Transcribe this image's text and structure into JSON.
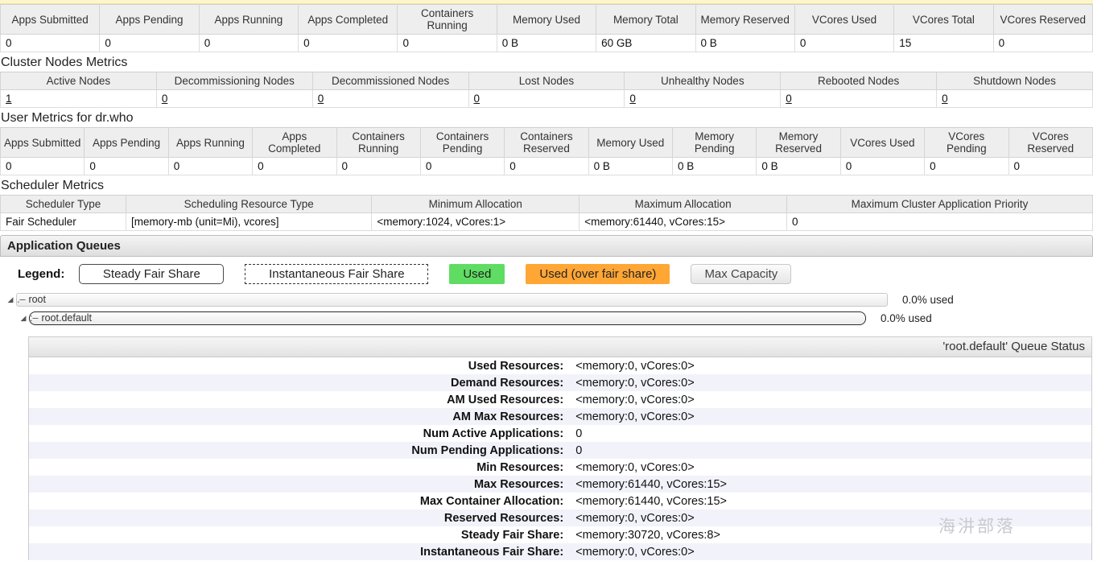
{
  "cluster_metrics": {
    "headers": [
      "Apps Submitted",
      "Apps Pending",
      "Apps Running",
      "Apps Completed",
      "Containers Running",
      "Memory Used",
      "Memory Total",
      "Memory Reserved",
      "VCores Used",
      "VCores Total",
      "VCores Reserved"
    ],
    "values": [
      "0",
      "0",
      "0",
      "0",
      "0",
      "0 B",
      "60 GB",
      "0 B",
      "0",
      "15",
      "0"
    ]
  },
  "cluster_nodes": {
    "title": "Cluster Nodes Metrics",
    "headers": [
      "Active Nodes",
      "Decommissioning Nodes",
      "Decommissioned Nodes",
      "Lost Nodes",
      "Unhealthy Nodes",
      "Rebooted Nodes",
      "Shutdown Nodes"
    ],
    "values": [
      "1",
      "0",
      "0",
      "0",
      "0",
      "0",
      "0"
    ]
  },
  "user_metrics": {
    "title": "User Metrics for dr.who",
    "headers": [
      "Apps Submitted",
      "Apps Pending",
      "Apps Running",
      "Apps Completed",
      "Containers Running",
      "Containers Pending",
      "Containers Reserved",
      "Memory Used",
      "Memory Pending",
      "Memory Reserved",
      "VCores Used",
      "VCores Pending",
      "VCores Reserved"
    ],
    "values": [
      "0",
      "0",
      "0",
      "0",
      "0",
      "0",
      "0",
      "0 B",
      "0 B",
      "0 B",
      "0",
      "0",
      "0"
    ]
  },
  "scheduler_metrics": {
    "title": "Scheduler Metrics",
    "headers": [
      "Scheduler Type",
      "Scheduling Resource Type",
      "Minimum Allocation",
      "Maximum Allocation",
      "Maximum Cluster Application Priority"
    ],
    "values": [
      "Fair Scheduler",
      "[memory-mb (unit=Mi), vcores]",
      "<memory:1024, vCores:1>",
      "<memory:61440, vCores:15>",
      "0"
    ]
  },
  "application_queues": {
    "title": "Application Queues",
    "legend": {
      "label": "Legend:",
      "steady": "Steady Fair Share",
      "instantaneous": "Instantaneous Fair Share",
      "used": "Used",
      "used_over": "Used (over fair share)",
      "max_capacity": "Max Capacity"
    },
    "colors": {
      "used": "#5fdc62",
      "used_over": "#ffa635",
      "max_capacity": "#e6e6e6"
    },
    "queues": [
      {
        "name": "root",
        "used_text": "0.0% used",
        "arrow": "◢",
        "dash": ".–"
      },
      {
        "name": "root.default",
        "used_text": "0.0% used",
        "arrow": "◢",
        "dash": ":–"
      }
    ]
  },
  "queue_status": {
    "title": "'root.default' Queue Status",
    "rows": [
      {
        "key": "Used Resources:",
        "value": "<memory:0, vCores:0>"
      },
      {
        "key": "Demand Resources:",
        "value": "<memory:0, vCores:0>"
      },
      {
        "key": "AM Used Resources:",
        "value": "<memory:0, vCores:0>"
      },
      {
        "key": "AM Max Resources:",
        "value": "<memory:0, vCores:0>"
      },
      {
        "key": "Num Active Applications:",
        "value": "0"
      },
      {
        "key": "Num Pending Applications:",
        "value": "0"
      },
      {
        "key": "Min Resources:",
        "value": "<memory:0, vCores:0>"
      },
      {
        "key": "Max Resources:",
        "value": "<memory:61440, vCores:15>"
      },
      {
        "key": "Max Container Allocation:",
        "value": "<memory:61440, vCores:15>"
      },
      {
        "key": "Reserved Resources:",
        "value": "<memory:0, vCores:0>"
      },
      {
        "key": "Steady Fair Share:",
        "value": "<memory:30720, vCores:8>"
      },
      {
        "key": "Instantaneous Fair Share:",
        "value": "<memory:0, vCores:0>"
      }
    ]
  },
  "watermark": {
    "text": "海汫部落"
  }
}
